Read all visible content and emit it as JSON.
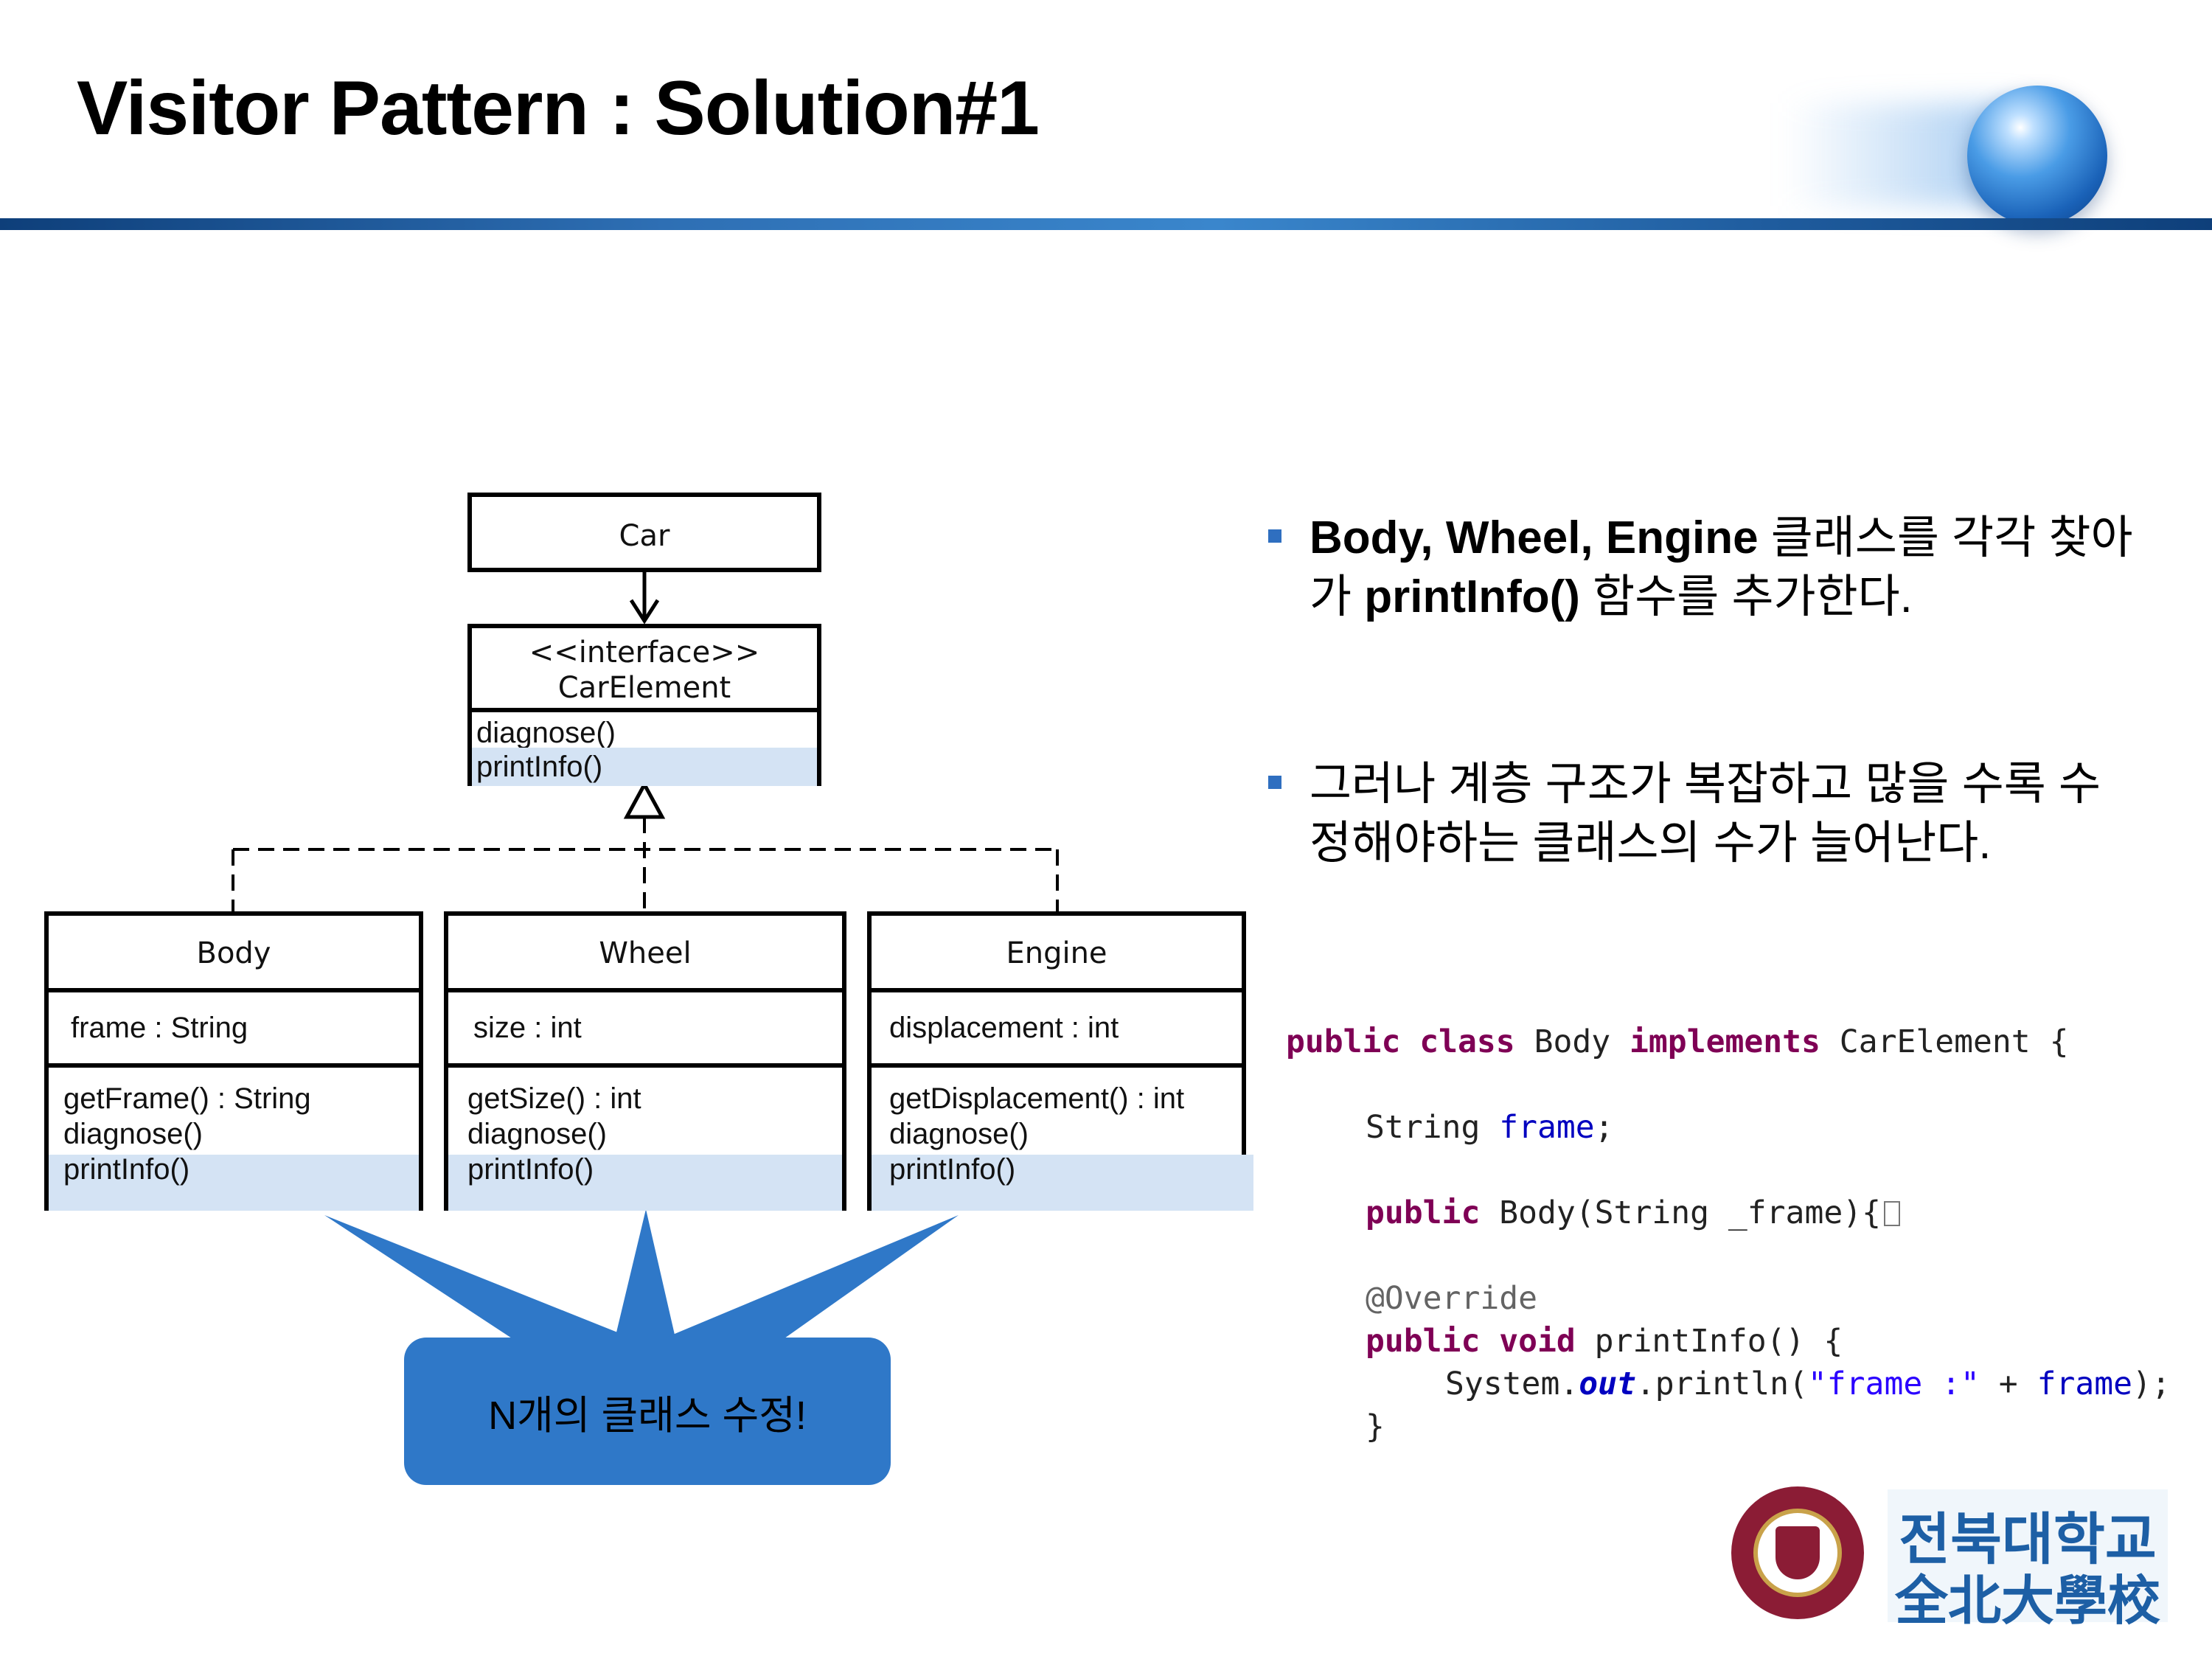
{
  "slide": {
    "title": "Visitor Pattern : Solution#1"
  },
  "uml": {
    "car": {
      "name": "Car"
    },
    "car_element": {
      "stereotype": "<<interface>>",
      "name": "CarElement",
      "methods": [
        "diagnose()",
        "printInfo()"
      ]
    },
    "body": {
      "name": "Body",
      "attributes": [
        "frame : String"
      ],
      "methods": [
        "getFrame() : String",
        "diagnose()",
        "printInfo()"
      ]
    },
    "wheel": {
      "name": "Wheel",
      "attributes": [
        "size : int"
      ],
      "methods": [
        "getSize() : int",
        "diagnose()",
        "printInfo()"
      ]
    },
    "engine": {
      "name": "Engine",
      "attributes": [
        "displacement : int"
      ],
      "methods": [
        "getDisplacement() : int",
        "diagnose()",
        "printInfo()"
      ]
    }
  },
  "callout": {
    "text": "N개의 클래스 수정!"
  },
  "bullets": [
    {
      "line1_bold": "Body, Wheel, Engine",
      "line1_rest": " 클래스를 각각 찾아",
      "line2_pre": "가 ",
      "line2_bold": "printInfo()",
      "line2_rest": " 함수를 추가한다."
    },
    {
      "line1": "그러나 계층 구조가 복잡하고 많을 수록 수",
      "line2": "정해야하는 클래스의 수가 늘어난다."
    }
  ],
  "code": {
    "l1_kw1": "public",
    "l1_kw2": "class",
    "l1_name": " Body ",
    "l1_kw3": "implements",
    "l1_rest": " CarElement {",
    "l2_type": "String ",
    "l2_field": "frame",
    "l2_end": ";",
    "l3_kw": "public",
    "l3_rest": " Body(String _frame){",
    "l4_ann": "@Override",
    "l5_kw1": "public",
    "l5_kw2": "void",
    "l5_rest": " printInfo() {",
    "l6_a": "System.",
    "l6_out": "out",
    "l6_b": ".println(",
    "l6_str": "\"frame :\"",
    "l6_c": " + ",
    "l6_field": "frame",
    "l6_d": ");",
    "l7": "}"
  },
  "logo": {
    "korean": "전북대학교",
    "hanja": "全北大學校"
  },
  "colors": {
    "accent_blue": "#2f78c8",
    "highlight": "#d4e3f4",
    "keyword": "#7f0055",
    "field": "#0000c0",
    "logo_maroon": "#8b1c35"
  }
}
